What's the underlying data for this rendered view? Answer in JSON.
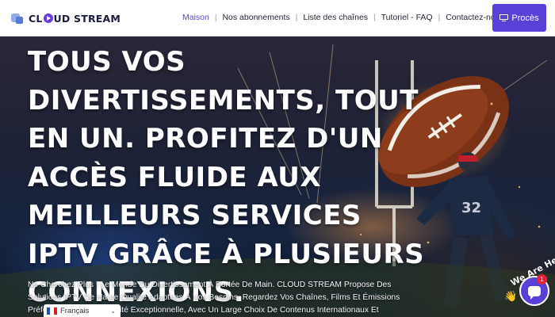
{
  "header": {
    "logo_text_1": "CL",
    "logo_text_2": "UD STREAM",
    "nav": [
      {
        "label": "Maison",
        "active": true
      },
      {
        "label": "Nos abonnements"
      },
      {
        "label": "Liste des chaînes"
      },
      {
        "label": "Tutoriel - FAQ"
      },
      {
        "label": "Contactez-nous"
      }
    ],
    "separator": "|",
    "cta_label": "Procès",
    "accent_color": "#5b3fd9"
  },
  "hero": {
    "title": "Tous vos divertissements, tout en un. Profitez d'un accès fluide aux meilleurs services IPTV grâce à plusieurs connexions.",
    "text": "Ne Cherchez Plus ! Le Monde Du Divertissement À Portée De Main. CLOUD STREAM Propose Des Solutions IPTV De Haute Qualité Adaptées À Vos Besoins. Regardez Vos Chaînes, Films Et Émissions Préférées Avec Une Qualité Exceptionnelle, Avec Un Large Choix De Contenus Internationaux Et Locaux."
  },
  "language": {
    "selected": "Français",
    "chevron": "⌄"
  },
  "chat": {
    "label": "We Are Here!",
    "badge_count": "1",
    "wave": "👋"
  }
}
